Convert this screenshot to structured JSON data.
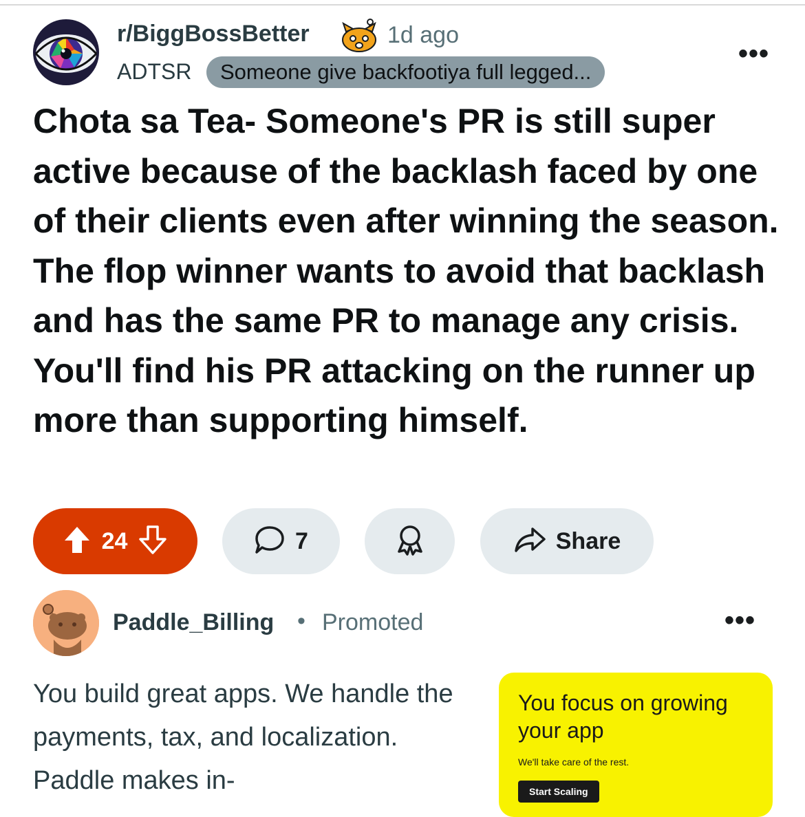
{
  "post": {
    "subreddit": "r/BiggBossBetter",
    "time_ago": "1d ago",
    "author": "ADTSR",
    "flair": "Someone give backfootiya full legged...",
    "more_icon": "ellipsis-icon",
    "title": "Chota sa Tea- Someone's PR is still super active because of the backlash faced by one of their clients even after winning the season. The flop winner wants to avoid that backlash and has the same PR to manage any crisis. You'll find his PR attacking on the runner up more than supporting himself."
  },
  "actions": {
    "vote_count": "24",
    "comment_count": "7",
    "share_label": "Share",
    "upvote_icon": "upvote-arrow-icon",
    "downvote_icon": "downvote-arrow-icon",
    "comment_icon": "speech-bubble-icon",
    "award_icon": "award-ribbon-icon",
    "share_icon": "share-arrow-icon"
  },
  "promoted": {
    "advertiser": "Paddle_Billing",
    "separator": "•",
    "label": "Promoted",
    "body": "You build great apps. We handle the payments, tax, and localization. Paddle makes in-",
    "creative": {
      "headline": "You focus on growing your app",
      "subtext": "We'll take care of the rest.",
      "cta": "Start Scaling"
    }
  },
  "colors": {
    "upvote_accent": "#d93a00",
    "pill_background": "#e5ebee",
    "flair_background": "#8a9ba3",
    "creative_background": "#f8f200",
    "meta_text": "#576f76"
  }
}
